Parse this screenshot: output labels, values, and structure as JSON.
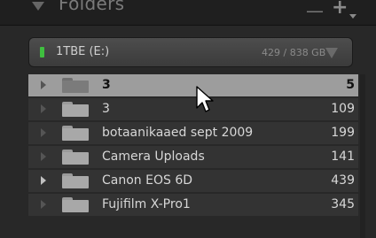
{
  "header": {
    "title": "Folders",
    "minus": "—",
    "plus": "+"
  },
  "volume": {
    "name": "1TBE (E:)",
    "size": "429 / 838 GB"
  },
  "folders": [
    {
      "label": "3",
      "count": "5",
      "selected": true,
      "disclosure": "dotted"
    },
    {
      "label": "3",
      "count": "109",
      "selected": false,
      "disclosure": "dotted"
    },
    {
      "label": "botaanikaaed sept 2009",
      "count": "199",
      "selected": false,
      "disclosure": "dotted"
    },
    {
      "label": "Camera Uploads",
      "count": "141",
      "selected": false,
      "disclosure": "dotted"
    },
    {
      "label": "Canon EOS 6D",
      "count": "439",
      "selected": false,
      "disclosure": "solid"
    },
    {
      "label": "Fujifilm X-Pro1",
      "count": "345",
      "selected": false,
      "disclosure": "dotted"
    }
  ],
  "colors": {
    "selected_row": "#9d9d9d",
    "row": "#333333",
    "led": "#3fbf3f"
  }
}
